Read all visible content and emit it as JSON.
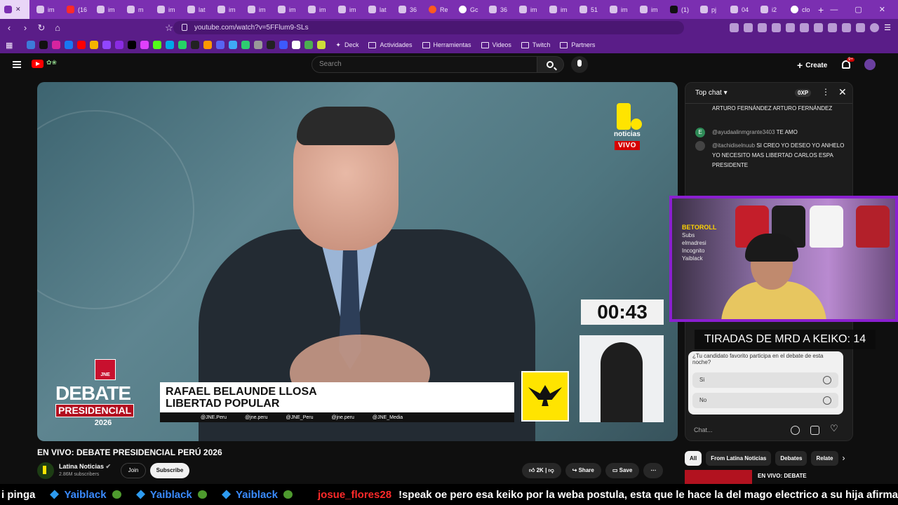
{
  "browser": {
    "tabs": [
      {
        "label": "",
        "icon": "twitch-icon"
      },
      {
        "label": "im",
        "icon": "page-icon"
      },
      {
        "label": "(16",
        "icon": "youtube-icon"
      },
      {
        "label": "im",
        "icon": "page-icon"
      },
      {
        "label": "m",
        "icon": "page-icon"
      },
      {
        "label": "im",
        "icon": "page-icon"
      },
      {
        "label": "lat",
        "icon": "page-icon"
      },
      {
        "label": "im",
        "icon": "page-icon"
      },
      {
        "label": "im",
        "icon": "page-icon"
      },
      {
        "label": "im",
        "icon": "page-icon"
      },
      {
        "label": "im",
        "icon": "page-icon"
      },
      {
        "label": "im",
        "icon": "page-icon"
      },
      {
        "label": "lat",
        "icon": "page-icon"
      },
      {
        "label": "36",
        "icon": "page-icon"
      },
      {
        "label": "Re",
        "icon": "reddit-icon"
      },
      {
        "label": "Gc",
        "icon": "google-icon"
      },
      {
        "label": "36",
        "icon": "page-icon"
      },
      {
        "label": "im",
        "icon": "page-icon"
      },
      {
        "label": "im",
        "icon": "page-icon"
      },
      {
        "label": "51",
        "icon": "page-icon"
      },
      {
        "label": "im",
        "icon": "page-icon"
      },
      {
        "label": "im",
        "icon": "page-icon"
      },
      {
        "label": "(1)",
        "icon": "x-icon"
      },
      {
        "label": "pj",
        "icon": "page-icon"
      },
      {
        "label": "04",
        "icon": "page-icon"
      },
      {
        "label": "i2",
        "icon": "page-icon"
      },
      {
        "label": "clo",
        "icon": "google-icon"
      }
    ],
    "url": "youtube.com/watch?v=5FFlum9-SLs",
    "bookmarks": [
      "Deck",
      "Actividades",
      "Herramientas",
      "Videos",
      "Twitch",
      "Partners"
    ],
    "accent": "#7b2fb1"
  },
  "youtube": {
    "search_placeholder": "Search",
    "create_label": "Create",
    "notif_count": "9+",
    "video_title": "EN VIVO: DEBATE PRESIDENCIAL PERÚ 2026",
    "channel": "Latina Noticias",
    "subscribers": "2.86M subscribers",
    "join": "Join",
    "subscribe": "Subscribe",
    "likes": "2K",
    "share": "Share",
    "save": "Save"
  },
  "overlay": {
    "brand": "noticias",
    "live": "VIVO",
    "timer": "00:43",
    "debate_word": "DEBATE",
    "presidencial": "PRESIDENCIAL",
    "year": "2026",
    "jne": "JNE",
    "speaker_name": "RAFAEL BELAUNDE LLOSA",
    "speaker_party": "LIBERTAD POPULAR",
    "socials": [
      "@JNE.Peru",
      "@jne.peru",
      "@JNE_Peru",
      "@jne.peru",
      "@JNE_Media"
    ]
  },
  "chat": {
    "header": "Top chat",
    "points": "0XP",
    "messages": [
      {
        "user": "",
        "text": "ARTURO FERNÁNDEZ ARTURO FERNÁNDEZ"
      },
      {
        "user": "@ayudaalinmgrante3403",
        "text": "TE AMO"
      },
      {
        "user": "@itachidiselnuub",
        "text": "SI CREO YO DESEO YO ANHELO YO NECESITO MAS LIBERTAD CARLOS ESPA PRESIDENTE"
      }
    ],
    "poll_question": "¿Tu candidato favorito participa en el debate de esta noche?",
    "poll_options": [
      "Si",
      "No"
    ],
    "input_placeholder": "Chat..."
  },
  "stream": {
    "counter": "TIRADAS DE MRD A KEIKO: 14",
    "cam_lines": [
      "BETOROLL",
      "Subs",
      "elmadresi",
      "Incognito",
      "Yaiblack"
    ]
  },
  "related": {
    "chips": [
      "All",
      "From Latina Noticias",
      "Debates",
      "Relate"
    ],
    "first_title": "EN VIVO: DEBATE"
  },
  "ticker": {
    "lead": "i pinga",
    "names": [
      "Yaiblack",
      "Yaiblack",
      "Yaiblack"
    ],
    "user": "josue_flores28",
    "message": "!speak oe pero esa keiko por la weba postula, esta que le hace la del mago electrico a su hija afirma"
  }
}
